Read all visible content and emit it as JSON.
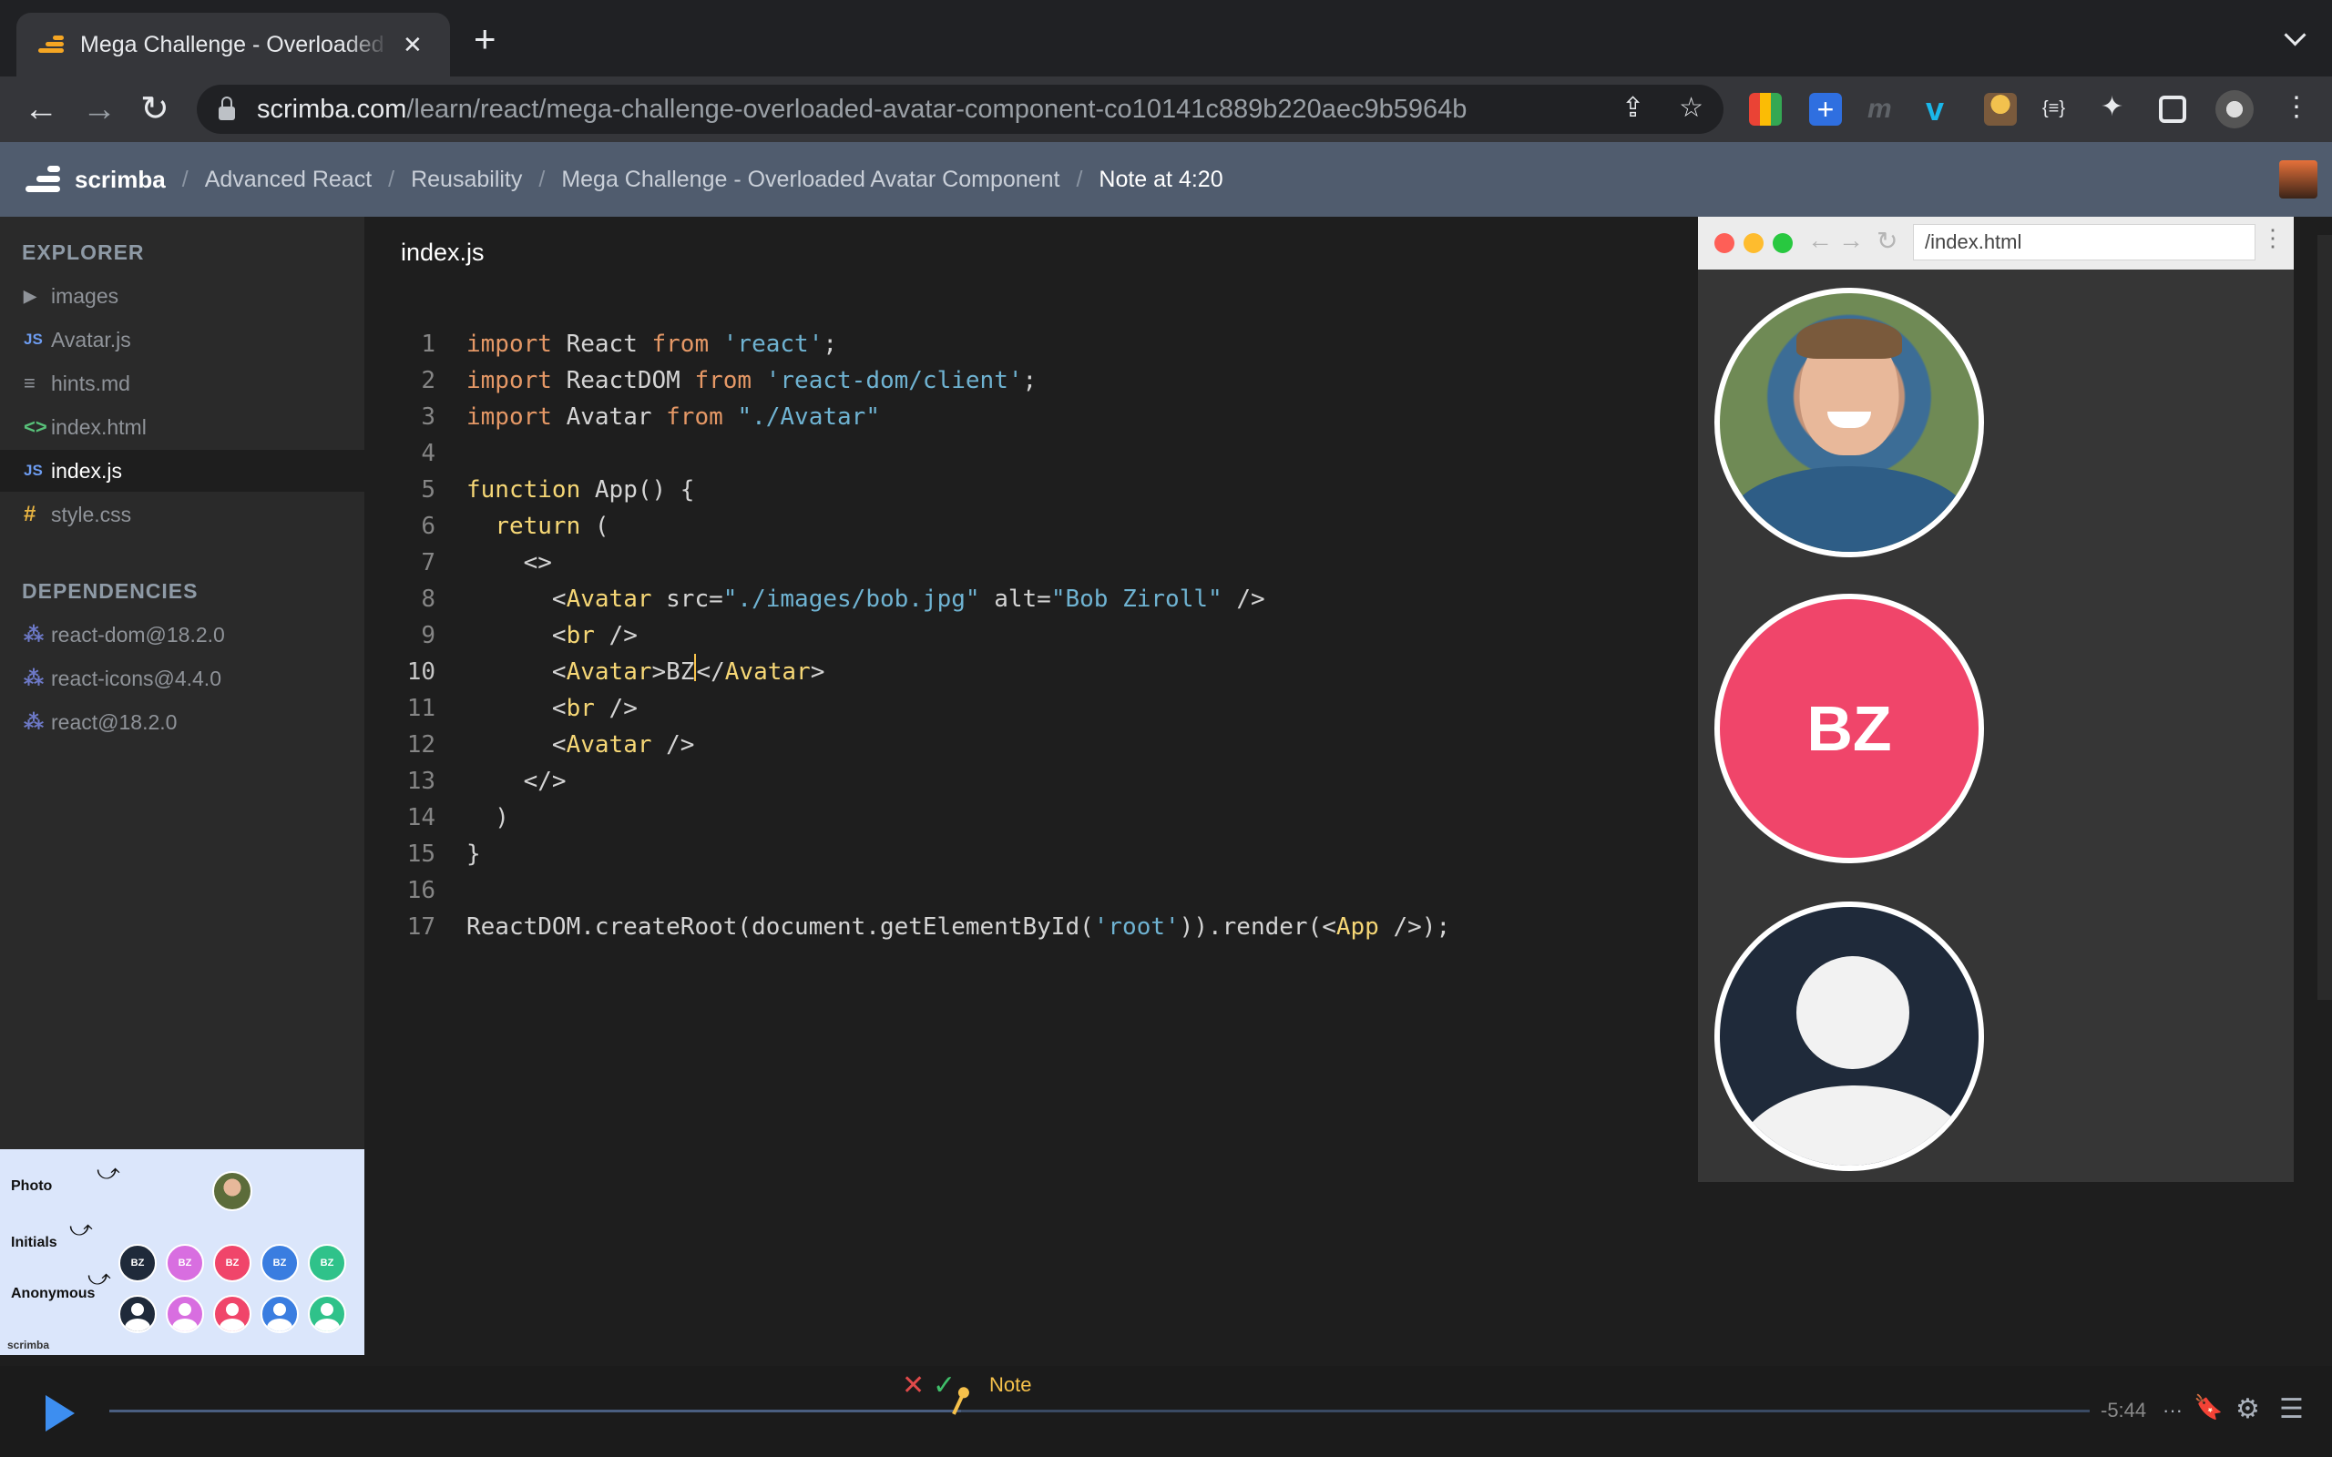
{
  "browser": {
    "tab_title": "Mega Challenge - Overloaded Avatar Component",
    "tab_close": "✕",
    "new_tab": "+",
    "url_host": "scrimba.com",
    "url_path": "/learn/react/mega-challenge-overloaded-avatar-component-co10141c889b220aec9b5964b",
    "back": "←",
    "forward": "→",
    "reload": "↻",
    "share_icon": "⇪",
    "star_icon": "☆",
    "extensions_text": "{≡}",
    "puzzle_icon": "✦",
    "menu_icon": "⋮"
  },
  "header": {
    "brand": "scrimba",
    "breadcrumbs": [
      "Advanced React",
      "Reusability",
      "Mega Challenge - Overloaded Avatar Component",
      "Note at 4:20"
    ],
    "separator": "/"
  },
  "sidebar": {
    "explorer_title": "EXPLORER",
    "files": [
      {
        "icon": "▶",
        "kind": "folder",
        "label": "images"
      },
      {
        "icon": "JS",
        "kind": "js",
        "label": "Avatar.js"
      },
      {
        "icon": "≡",
        "kind": "md",
        "label": "hints.md"
      },
      {
        "icon": "<>",
        "kind": "html",
        "label": "index.html"
      },
      {
        "icon": "JS",
        "kind": "js",
        "label": "index.js"
      },
      {
        "icon": "#",
        "kind": "css",
        "label": "style.css"
      }
    ],
    "deps_title": "DEPENDENCIES",
    "dependencies": [
      {
        "icon": "⁂",
        "label": "react-dom@18.2.0"
      },
      {
        "icon": "⁂",
        "label": "react-icons@4.4.0"
      },
      {
        "icon": "⁂",
        "label": "react@18.2.0"
      }
    ]
  },
  "slide": {
    "labels": [
      "Photo",
      "Initials",
      "Anonymous"
    ],
    "initials": "BZ",
    "brand": "scrimba",
    "arrow": "⤻",
    "colors": [
      "#1f2a3a",
      "#d86ee0",
      "#f0456a",
      "#3a7de0",
      "#2fc28a"
    ]
  },
  "editor": {
    "filename": "index.js",
    "current_line": 10,
    "lines": [
      "1",
      "2",
      "3",
      "4",
      "5",
      "6",
      "7",
      "8",
      "9",
      "10",
      "11",
      "12",
      "13",
      "14",
      "15",
      "16",
      "17"
    ]
  },
  "preview": {
    "url": "/index.html",
    "nav_back": "←",
    "nav_forward": "→",
    "nav_reload": "↻",
    "menu": "⋮",
    "initials": "BZ"
  },
  "player": {
    "time_remaining": "-5:44",
    "more": "···",
    "note_label": "Note",
    "reject_icon": "✕",
    "accept_icon": "✓",
    "bookmark_icon": "🔖",
    "settings_icon": "⚙",
    "list_icon": "☰",
    "progress": 0.43
  },
  "colors": {
    "accent": "#3d8ef0",
    "header_bg": "#505c6e",
    "note": "#f6c14b",
    "initials_bg": "#f0456a"
  }
}
